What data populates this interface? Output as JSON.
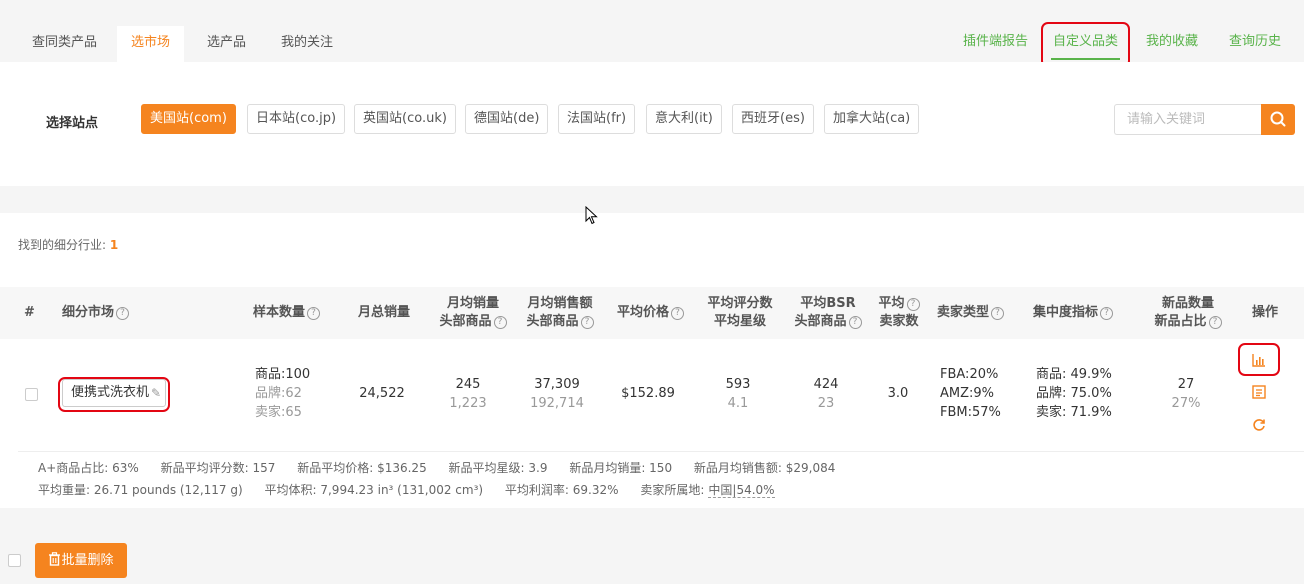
{
  "tabs": [
    "查同类产品",
    "选市场",
    "选产品",
    "我的关注"
  ],
  "right_tabs": [
    "插件端报告",
    "自定义品类",
    "我的收藏",
    "查询历史"
  ],
  "site": {
    "label": "选择站点",
    "options": [
      "美国站(com)",
      "日本站(co.jp)",
      "英国站(co.uk)",
      "德国站(de)",
      "法国站(fr)",
      "意大利(it)",
      "西班牙(es)",
      "加拿大站(ca)"
    ],
    "selected": "美国站(com)"
  },
  "search": {
    "placeholder": "请输入关键词"
  },
  "found": {
    "label": "找到的细分行业:",
    "count": "1"
  },
  "table": {
    "headers": {
      "num": "#",
      "market": "细分市场",
      "sample": "样本数量",
      "monthly_total": "月总销量",
      "avg_sales_1": "月均销量",
      "avg_sales_2": "头部商品",
      "avg_revenue_1": "月均销售额",
      "avg_revenue_2": "头部商品",
      "avg_price": "平均价格",
      "avg_rating_1": "平均评分数",
      "avg_rating_2": "平均星级",
      "avg_bsr_1": "平均BSR",
      "avg_bsr_2": "头部商品",
      "avg_sellers_1": "平均",
      "avg_sellers_2": "卖家数",
      "seller_type": "卖家类型",
      "concentration": "集中度指标",
      "new_count_1": "新品数量",
      "new_count_2": "新品占比",
      "ops": "操作"
    },
    "row": {
      "market": "便携式洗衣机",
      "sample_products": "商品:100",
      "sample_brands": "品牌:62",
      "sample_sellers": "卖家:65",
      "monthly_total": "24,522",
      "avg_sales": "245",
      "avg_sales_top": "1,223",
      "avg_revenue": "37,309",
      "avg_revenue_top": "192,714",
      "avg_price": "$152.89",
      "avg_rating_count": "593",
      "avg_stars": "4.1",
      "avg_bsr": "424",
      "avg_bsr_top": "23",
      "avg_sellers": "3.0",
      "fba": "FBA:20%",
      "amz": "AMZ:9%",
      "fbm": "FBM:57%",
      "conc_product": "商品: 49.9%",
      "conc_brand": "品牌: 75.0%",
      "conc_seller": "卖家: 71.9%",
      "new_count": "27",
      "new_ratio": "27%"
    },
    "extra_line1": [
      "A+商品占比: 63%",
      "新品平均评分数: 157",
      "新品平均价格: $136.25",
      "新品平均星级: 3.9",
      "新品月均销量: 150",
      "新品月均销售额: $29,084"
    ],
    "extra_line2": [
      "平均重量: 26.71 pounds (12,117 g)",
      "平均体积: 7,994.23 in³ (131,002 cm³)",
      "平均利润率: 69.32%",
      "卖家所属地:"
    ],
    "seller_origin": "中国|54.0%"
  },
  "batch_delete": "批量删除",
  "colors": {
    "accent": "#f5841f",
    "green": "#59b34a",
    "highlight": "#e30613"
  },
  "icons": [
    "search-icon",
    "pencil-icon",
    "chart-icon",
    "report-icon",
    "refresh-icon",
    "trash-icon",
    "help-icon"
  ]
}
